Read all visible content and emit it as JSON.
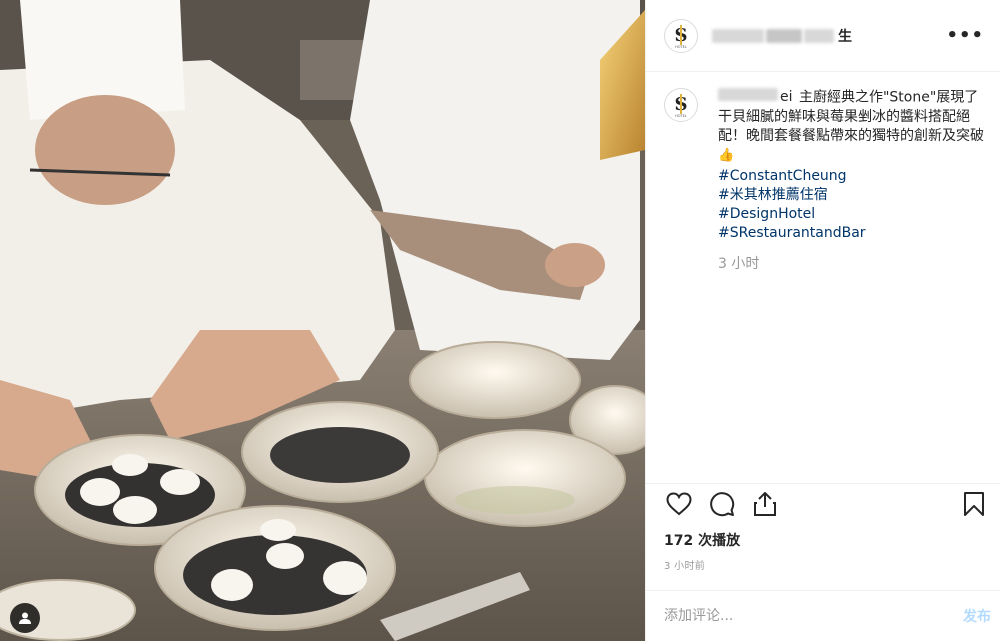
{
  "media": {
    "alt_subject": "chefs-plating-dish-photo"
  },
  "header": {
    "username_visible_suffix": "生",
    "more_icon": "more-horizontal-icon",
    "more_label": "•••"
  },
  "caption": {
    "username_visible_suffix": "ei",
    "text": "主廚經典之作\"Stone\"展現了干貝細膩的鮮味與莓果剉冰的醬料搭配絕配！晚間套餐餐點帶來的獨特的創新及突破",
    "emoji": "👍",
    "hashtags": [
      "#ConstantCheung",
      "#米其林推薦住宿",
      "#DesignHotel",
      "#SRestaurantandBar"
    ],
    "time": "3 小时"
  },
  "actions": {
    "like_icon": "heart-icon",
    "comment_icon": "comment-bubble-icon",
    "share_icon": "share-upload-icon",
    "save_icon": "bookmark-icon",
    "plays": "172 次播放",
    "posted_time": "3 小时前"
  },
  "comment": {
    "placeholder": "添加评论...",
    "post_label": "发布"
  },
  "colors": {
    "hashtag": "#003569",
    "post_disabled": "#b3dbff",
    "muted": "#999999",
    "border": "#efefef"
  }
}
